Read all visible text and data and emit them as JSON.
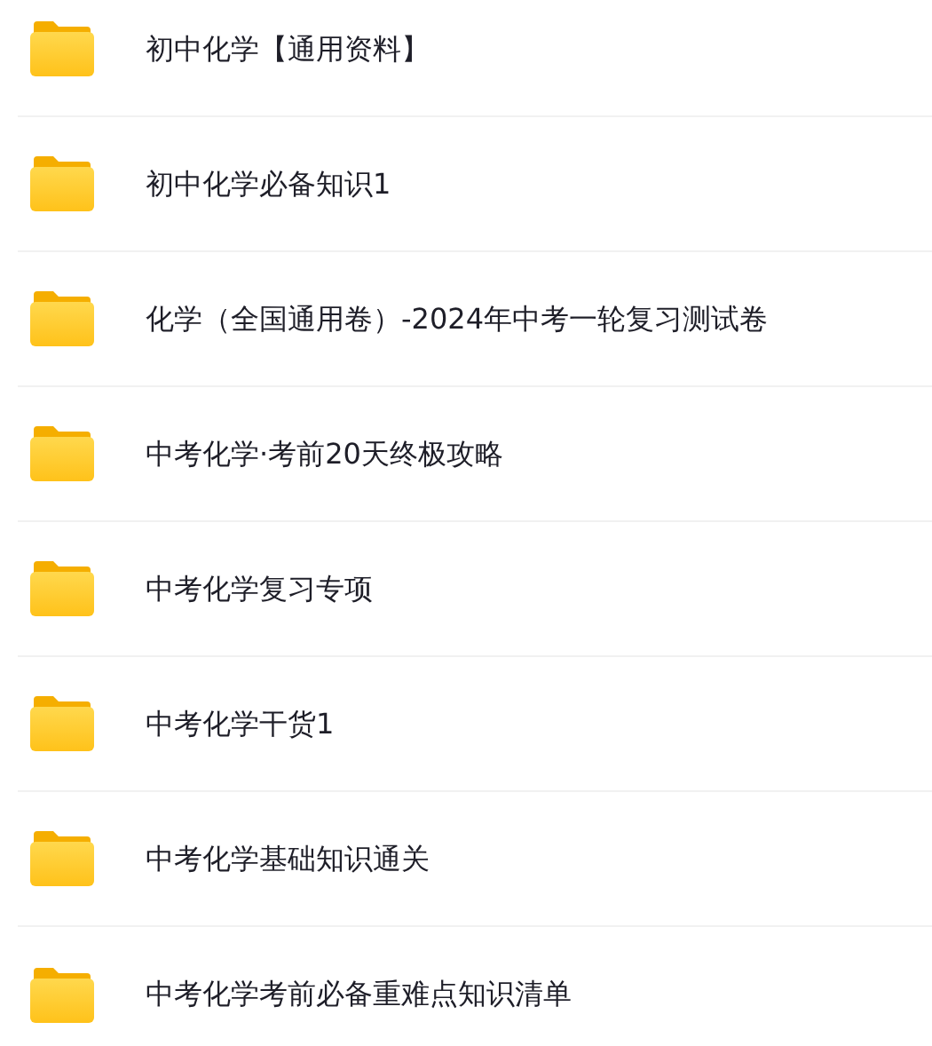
{
  "folders": [
    {
      "name": "初中化学【通用资料】"
    },
    {
      "name": "初中化学必备知识1"
    },
    {
      "name": "化学（全国通用卷）-2024年中考一轮复习测试卷"
    },
    {
      "name": "中考化学·考前20天终极攻略"
    },
    {
      "name": "中考化学复习专项"
    },
    {
      "name": "中考化学干货1"
    },
    {
      "name": "中考化学基础知识通关"
    },
    {
      "name": "中考化学考前必备重难点知识清单"
    }
  ]
}
